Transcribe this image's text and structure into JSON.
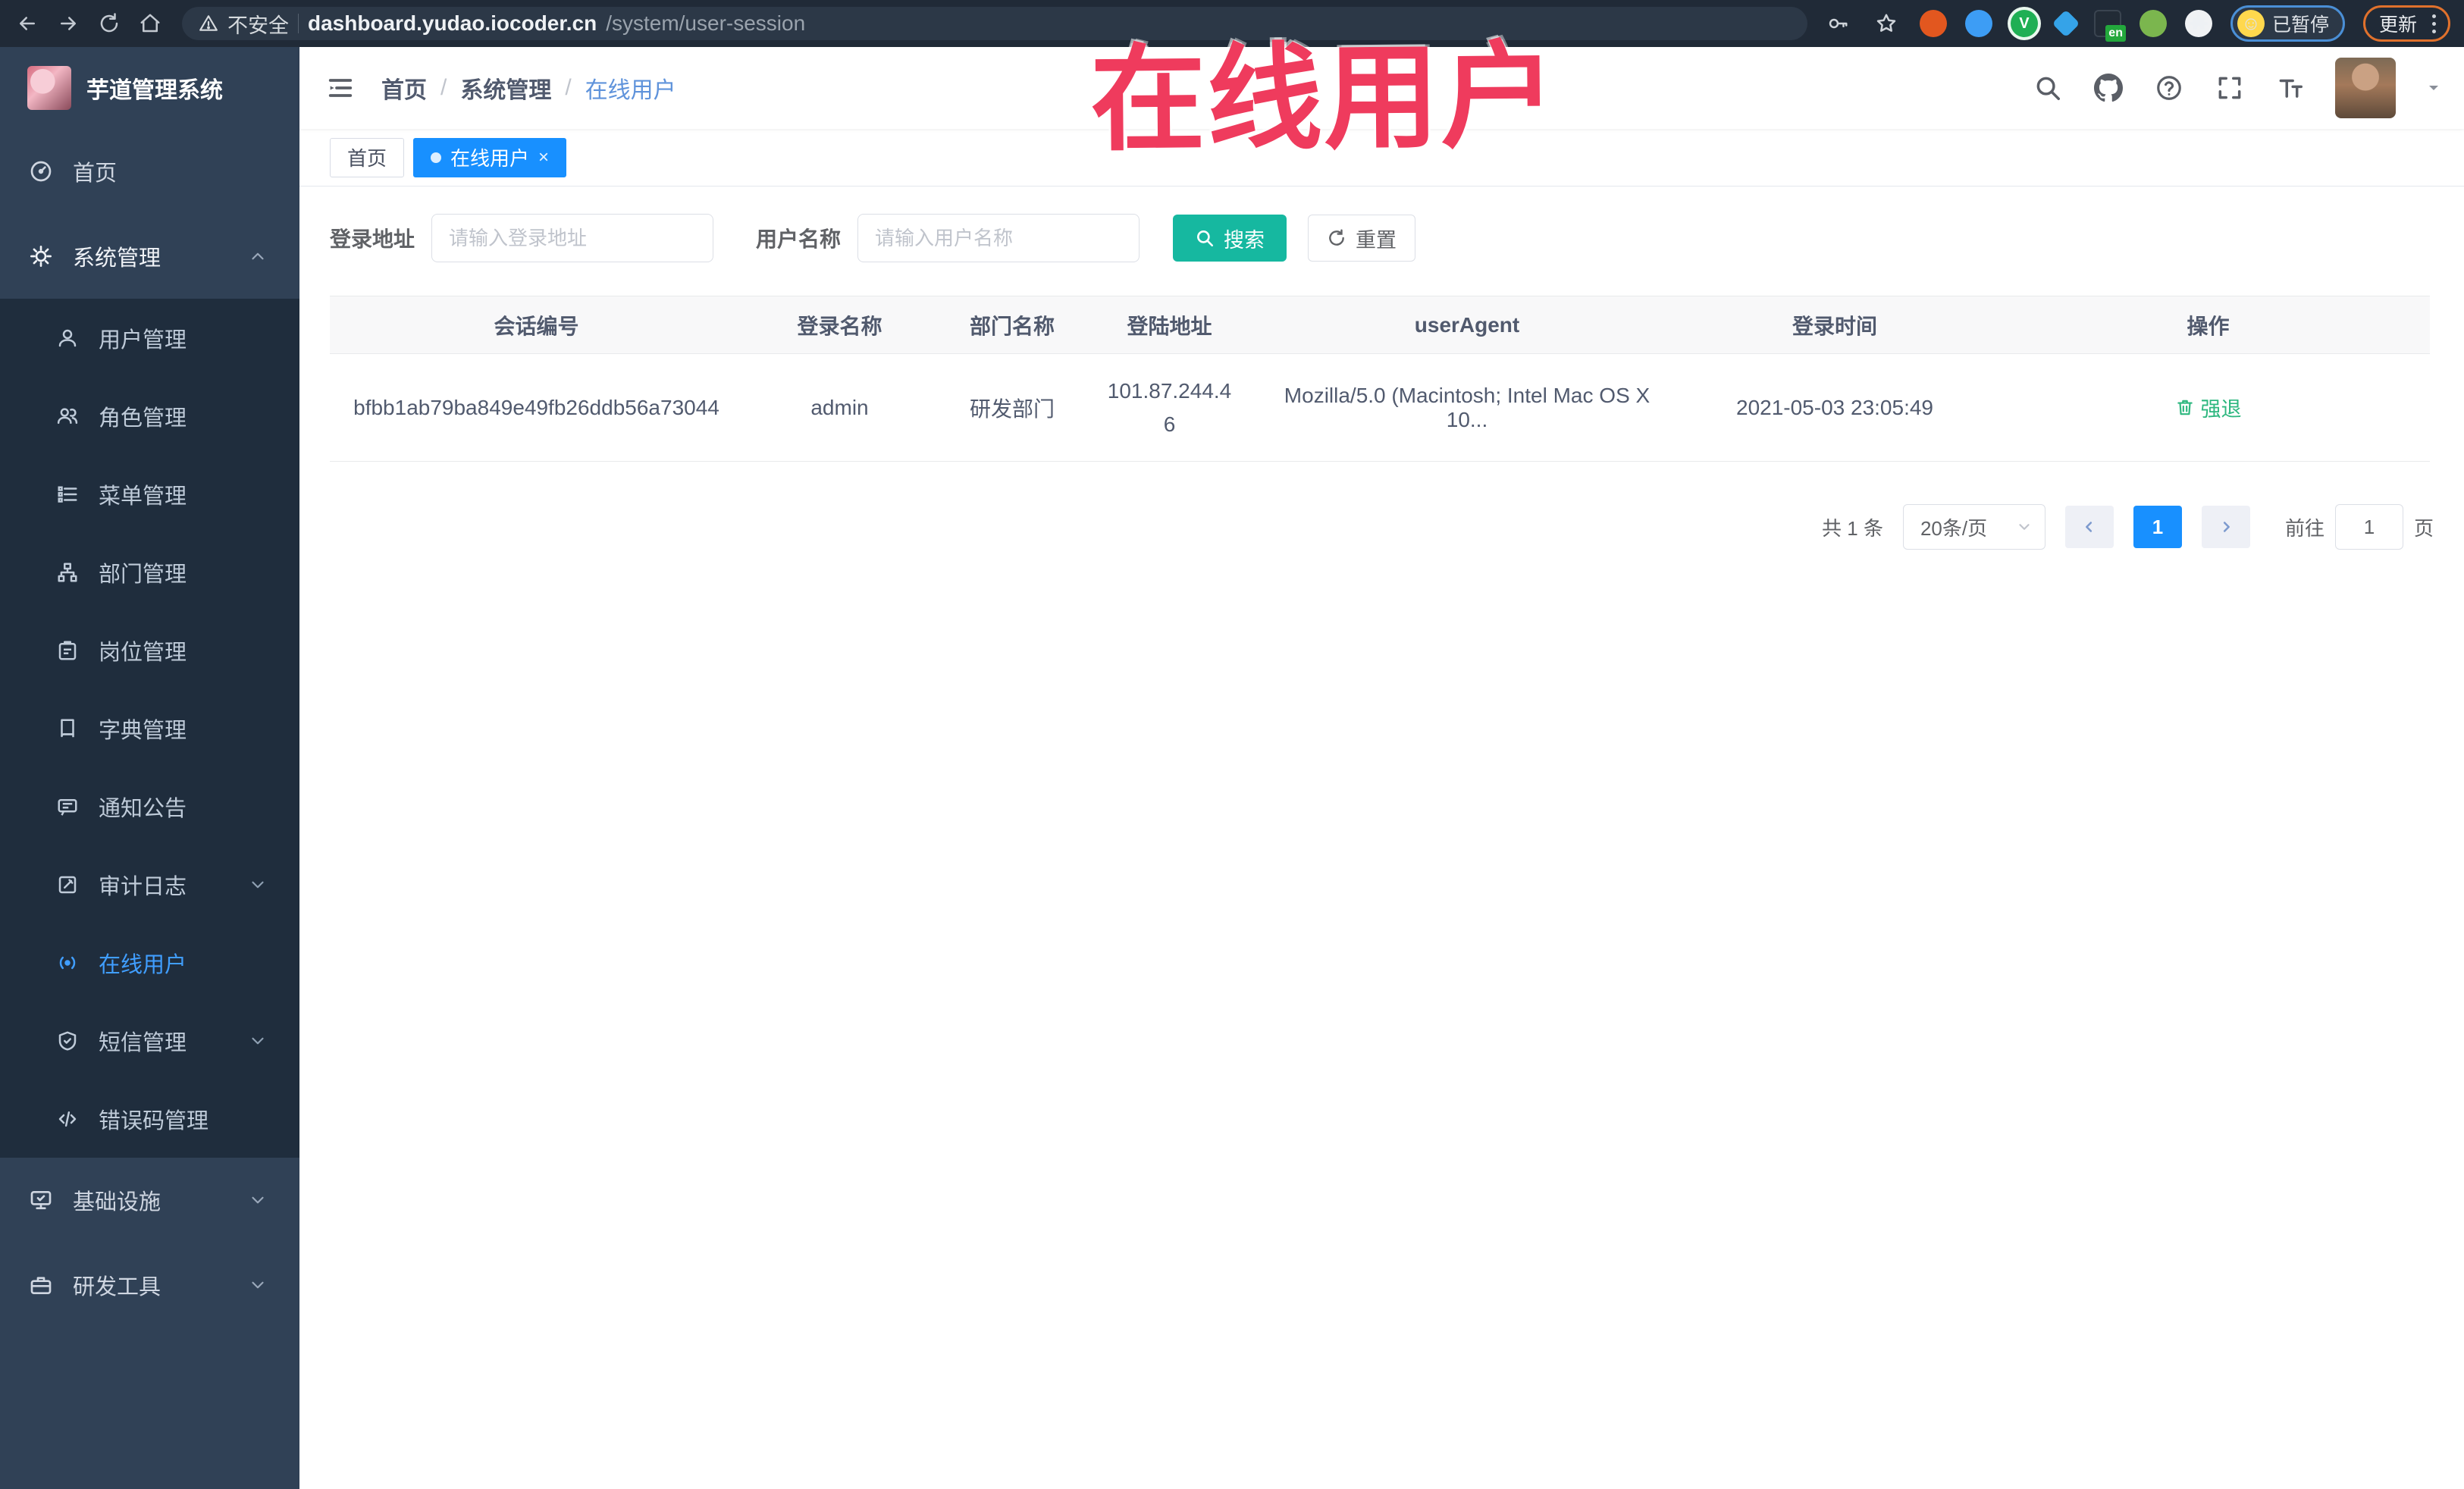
{
  "browser": {
    "security_label": "不安全",
    "url_domain": "dashboard.yudao.iocoder.cn",
    "url_path": "/system/user-session",
    "extension_badge": "en",
    "profile_status": "已暂停",
    "update_label": "更新"
  },
  "watermark": "在线用户",
  "sidebar": {
    "app_title": "芋道管理系统",
    "items": [
      {
        "label": "首页",
        "icon": "dashboard-icon"
      },
      {
        "label": "系统管理",
        "icon": "gear-icon",
        "expanded": true
      },
      {
        "label": "用户管理",
        "icon": "user-icon"
      },
      {
        "label": "角色管理",
        "icon": "users-icon"
      },
      {
        "label": "菜单管理",
        "icon": "menu-list-icon"
      },
      {
        "label": "部门管理",
        "icon": "org-tree-icon"
      },
      {
        "label": "岗位管理",
        "icon": "badge-icon"
      },
      {
        "label": "字典管理",
        "icon": "dictionary-icon"
      },
      {
        "label": "通知公告",
        "icon": "announcement-icon"
      },
      {
        "label": "审计日志",
        "icon": "audit-log-icon",
        "collapsed": true
      },
      {
        "label": "在线用户",
        "icon": "online-user-icon",
        "active": true
      },
      {
        "label": "短信管理",
        "icon": "sms-shield-icon",
        "collapsed": true
      },
      {
        "label": "错误码管理",
        "icon": "error-code-icon"
      },
      {
        "label": "基础设施",
        "icon": "infrastructure-icon",
        "collapsed": true
      },
      {
        "label": "研发工具",
        "icon": "dev-tools-icon",
        "collapsed": true
      }
    ]
  },
  "header": {
    "breadcrumb": [
      "首页",
      "系统管理",
      "在线用户"
    ],
    "icons": [
      "search-icon",
      "github-icon",
      "help-icon",
      "fullscreen-icon",
      "font-size-icon"
    ]
  },
  "tabs": [
    {
      "label": "首页",
      "active": false
    },
    {
      "label": "在线用户",
      "active": true
    }
  ],
  "filters": {
    "address_label": "登录地址",
    "address_placeholder": "请输入登录地址",
    "name_label": "用户名称",
    "name_placeholder": "请输入用户名称",
    "search_label": "搜索",
    "reset_label": "重置"
  },
  "table": {
    "columns": [
      "会话编号",
      "登录名称",
      "部门名称",
      "登陆地址",
      "userAgent",
      "登录时间",
      "操作"
    ],
    "rows": [
      {
        "session_id": "bfbb1ab79ba849e49fb26ddb56a73044",
        "login_name": "admin",
        "dept_name": "研发部门",
        "login_ip": "101.87.244.46",
        "user_agent": "Mozilla/5.0 (Macintosh; Intel Mac OS X 10...",
        "login_time": "2021-05-03 23:05:49",
        "action_label": "强退"
      }
    ]
  },
  "pagination": {
    "total_text": "共 1 条",
    "page_size": "20条/页",
    "current_page": "1",
    "goto_label": "前往",
    "goto_value": "1",
    "goto_unit": "页"
  },
  "colors": {
    "primary_blue": "#1890ff",
    "menu_active_blue": "#409eff",
    "search_teal": "#16b8a0",
    "action_green": "#2db77f",
    "watermark_red": "#ef3b5d",
    "sidebar_bg": "#304156",
    "submenu_bg": "#1f2d3d",
    "browser_bar_bg": "#202a37"
  }
}
